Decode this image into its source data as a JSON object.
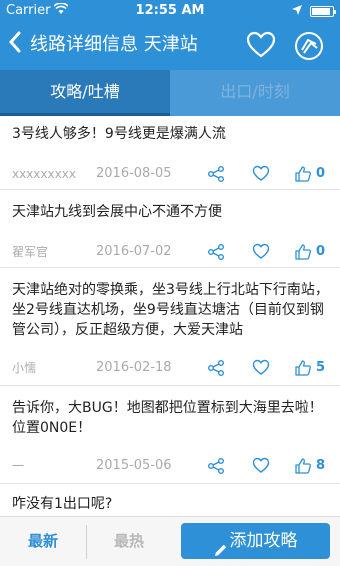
{
  "status_bar": {
    "carrier": "Carrier",
    "time": "12:55 AM"
  },
  "nav": {
    "title": "线路详细信息 天津站",
    "back_icon": "chevron-left-icon",
    "favorite_icon": "heart-outline-icon",
    "logo_icon": "metro-logo-icon"
  },
  "tabs": [
    {
      "label": "攻略/吐槽",
      "active": true
    },
    {
      "label": "出口/时刻",
      "active": false
    }
  ],
  "posts": [
    {
      "content": "3号线人够多！9号线更是爆满人流",
      "author": "xxxxxxxxx",
      "date": "2016-08-05",
      "likes": "0"
    },
    {
      "content": "天津站九线到会展中心不通不方便",
      "author": "翟军官",
      "date": "2016-07-02",
      "likes": "0"
    },
    {
      "content": "天津站绝对的零换乘，坐3号线上行北站下行南站，坐2号线直达机场，坐9号线直达塘沽（目前仅到钢管公司），反正超级方便，大爱天津站",
      "author": "小懦",
      "date": "2016-02-18",
      "likes": "5"
    },
    {
      "content": "告诉你，大BUG！地图都把位置标到大海里去啦！位置0N0E！",
      "author": "一",
      "date": "2015-05-06",
      "likes": "8"
    },
    {
      "content": "咋没有1出口呢?",
      "author": "",
      "date": "",
      "likes": ""
    }
  ],
  "bottom": {
    "newest": "最新",
    "hottest": "最热",
    "add": "添加攻略"
  },
  "colors": {
    "accent": "#2e90d6",
    "tab_active": "#2a79b8",
    "muted": "#aaaaaa"
  }
}
